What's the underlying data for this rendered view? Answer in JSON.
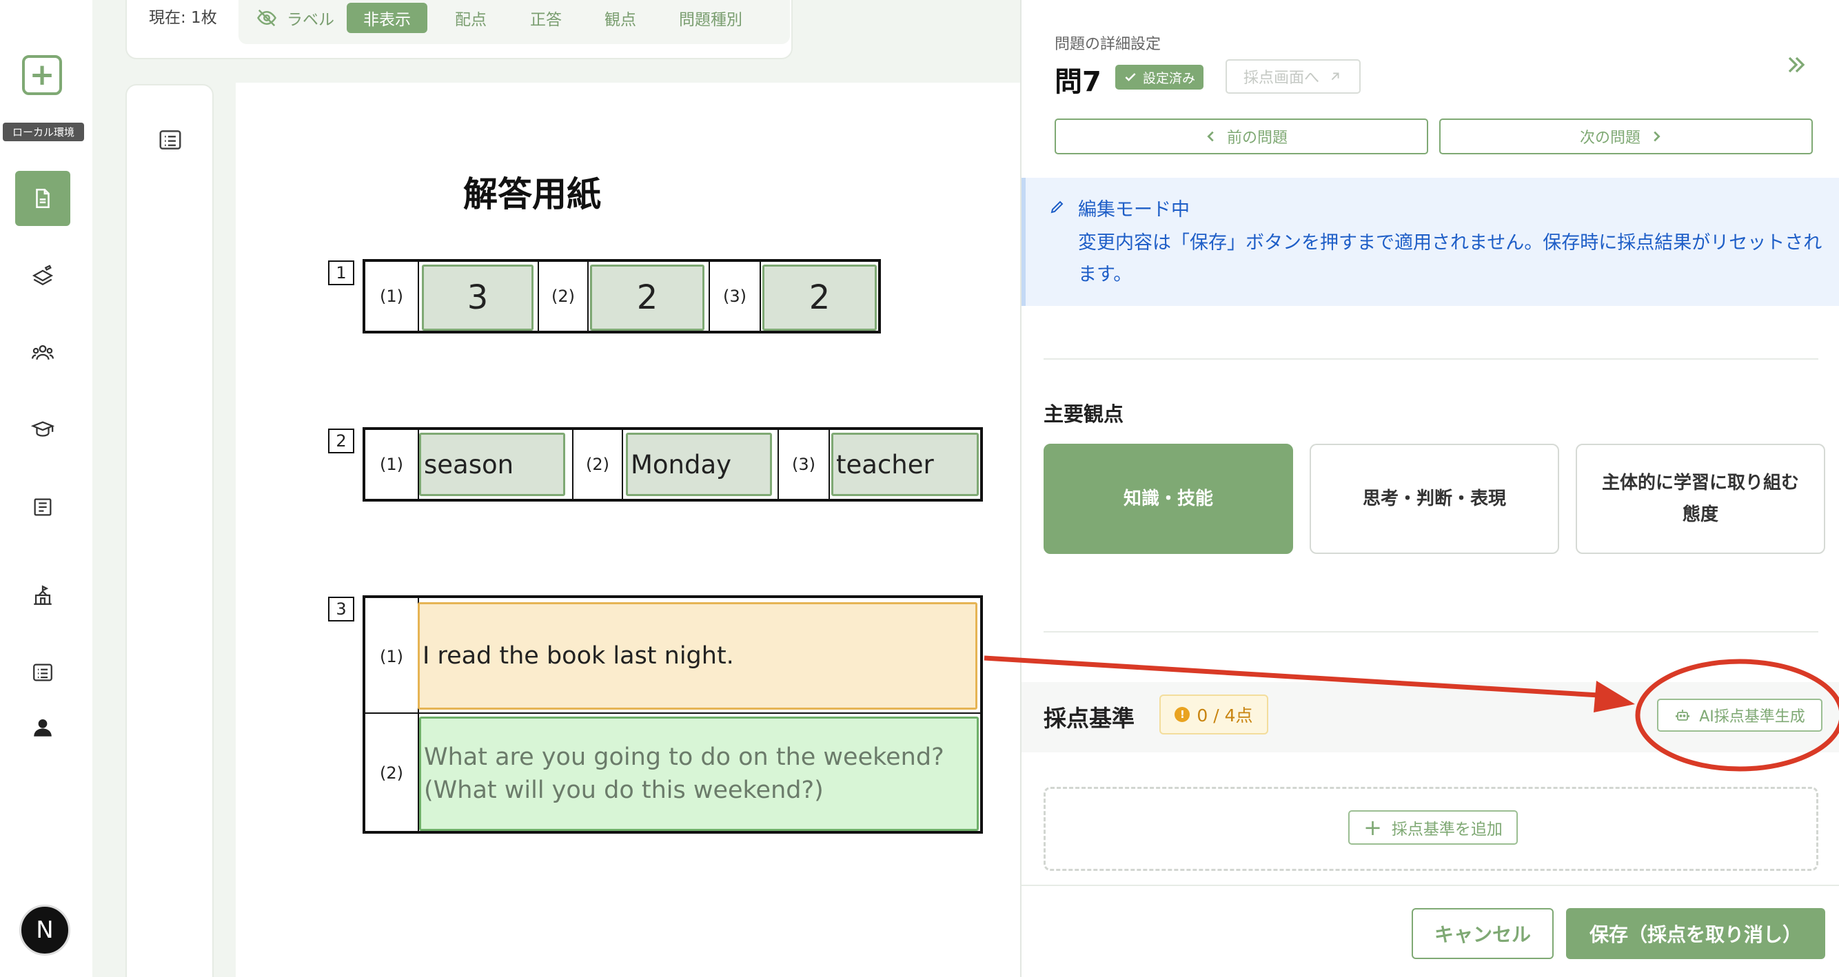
{
  "sidebar": {
    "add_label": "+",
    "env_badge": "ローカル環境",
    "avatar_letter": "N",
    "items": [
      {
        "icon": "document-icon",
        "active": true
      },
      {
        "icon": "stack-pen-icon",
        "active": false
      },
      {
        "icon": "group-icon",
        "active": false
      },
      {
        "icon": "student-cap-icon",
        "active": false
      },
      {
        "icon": "book-icon",
        "active": false
      },
      {
        "icon": "school-icon",
        "active": false
      },
      {
        "icon": "list-icon",
        "active": false
      },
      {
        "icon": "user-icon",
        "active": false
      }
    ]
  },
  "toolbar": {
    "current": "現在: 1枚",
    "tabs": [
      {
        "label": "ラベル",
        "icon": "eye-off-icon",
        "active": false
      },
      {
        "label": "非表示",
        "active": true
      },
      {
        "label": "配点",
        "active": false
      },
      {
        "label": "正答",
        "active": false
      },
      {
        "label": "観点",
        "active": false
      },
      {
        "label": "問題種別",
        "active": false
      }
    ]
  },
  "answer_sheet": {
    "title": "解答用紙",
    "q1": {
      "number": "1",
      "labels": [
        "(1)",
        "(2)",
        "(3)"
      ],
      "answers": [
        "3",
        "2",
        "2"
      ]
    },
    "q2": {
      "number": "2",
      "labels": [
        "(1)",
        "(2)",
        "(3)"
      ],
      "answers": [
        "season",
        "Monday",
        "teacher"
      ]
    },
    "q3": {
      "number": "3",
      "labels": [
        "(1)",
        "(2)"
      ],
      "answer1": "I read the book last night.",
      "answer2_line1": "What are you going to do on the weekend?",
      "answer2_line2": "(What will you do this weekend?)"
    }
  },
  "detail_panel": {
    "subtitle": "問題の詳細設定",
    "title": "問7",
    "status_badge": "設定済み",
    "grading_link": "採点画面へ",
    "prev_button": "前の問題",
    "next_button": "次の問題",
    "edit_mode_title": "編集モード中",
    "edit_mode_text": "変更内容は「保存」ボタンを押すまで適用されません。保存時に採点結果がリセットされます。",
    "viewpoint_heading": "主要観点",
    "viewpoints": [
      {
        "line1": "知識・技能",
        "line2": "",
        "active": true
      },
      {
        "line1": "思考・判断・表現",
        "line2": "",
        "active": false
      },
      {
        "line1": "主体的に学習に取り組む",
        "line2": "態度",
        "active": false
      }
    ],
    "criteria_heading": "採点基準",
    "criteria_points": "0 / 4点",
    "criteria_dot": "!",
    "ai_button": "AI採点基準生成",
    "add_criteria": "採点基準を追加",
    "add_criteria_plus": "+",
    "cancel_button": "キャンセル",
    "save_button": "保存（採点を取り消し）"
  },
  "colors": {
    "accent_green": "#7fa974",
    "info_blue": "#1e5ec7",
    "warning_orange": "#c88410",
    "annotation_red": "#d93a26"
  }
}
